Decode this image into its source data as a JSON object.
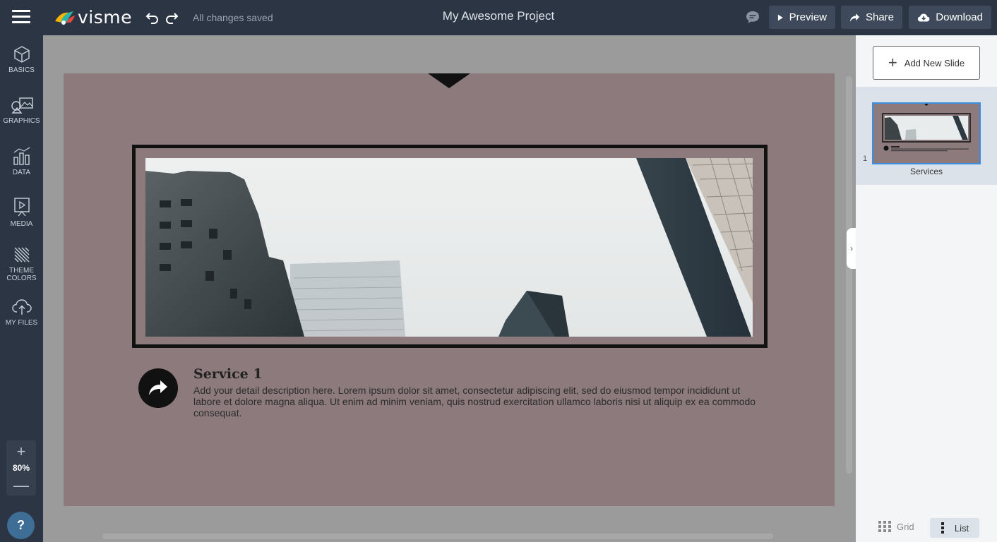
{
  "header": {
    "logo_text": "visme",
    "save_status": "All changes saved",
    "project_title": "My Awesome Project",
    "preview_label": "Preview",
    "share_label": "Share",
    "download_label": "Download"
  },
  "sidebar": {
    "items": [
      {
        "label": "BASICS",
        "icon": "cube-icon"
      },
      {
        "label": "GRAPHICS",
        "icon": "shapes-image-icon"
      },
      {
        "label": "DATA",
        "icon": "chart-icon"
      },
      {
        "label": "MEDIA",
        "icon": "media-play-icon"
      },
      {
        "label": "THEME",
        "label2": "COLORS",
        "icon": "theme-colors-icon"
      },
      {
        "label": "MY FILES",
        "icon": "cloud-upload-icon"
      }
    ],
    "zoom": {
      "plus": "+",
      "value": "80%",
      "minus": "—"
    },
    "help": "?"
  },
  "slide": {
    "service_title": "Service 1",
    "service_description": "Add your detail description here. Lorem ipsum dolor sit amet, consectetur adipiscing elit, sed do eiusmod tempor incididunt ut labore et dolore magna aliqua. Ut enim ad minim veniam, quis nostrud exercitation ullamco laboris nisi ut aliquip ex ea commodo consequat.",
    "background_color": "#8c7a7d"
  },
  "right_panel": {
    "add_slide_label": "Add New Slide",
    "slides": [
      {
        "number": "1",
        "label": "Services"
      }
    ],
    "view_grid_label": "Grid",
    "view_list_label": "List"
  },
  "colors": {
    "topbar": "#2b3544",
    "accent_selected": "#3a8fe0",
    "slide_bg": "#8c7a7d"
  }
}
